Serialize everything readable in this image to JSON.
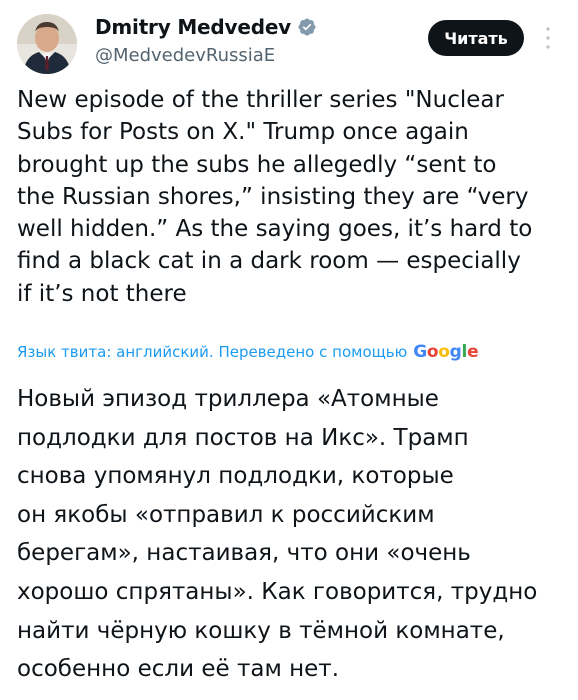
{
  "author": {
    "name": "Dmitry Medvedev",
    "handle": "@MedvedevRussiaE",
    "verified": true
  },
  "actions": {
    "read_label": "Читать",
    "more_icon": "more-vertical-icon"
  },
  "tweet": {
    "lines": [
      "New episode of the thriller series \"Nuclear",
      "Subs for Posts on X.\" Trump once again",
      "brought up the subs he allegedly “sent to",
      "the Russian shores,” insisting they are “very",
      "well hidden.” As the saying goes, it’s hard to",
      "find a black cat in a dark room — especially",
      "if it’s not there"
    ]
  },
  "translation": {
    "note": "Язык твита: английский. Переведено с помощью",
    "provider": "Google",
    "lines": [
      "Новый эпизод триллера «Атомные",
      "подлодки для постов на Икс». Трамп",
      "снова упомянул подлодки, которые",
      "он якобы «отправил к российским",
      "берегам», настаивая, что они «очень",
      "хорошо спрятаны». Как говорится, трудно",
      "найти чёрную кошку в тёмной комнате,",
      "особенно если её там нет."
    ]
  },
  "colors": {
    "text": "#0f1419",
    "secondary": "#536471",
    "link": "#1d9bf0",
    "verified": "#829aab",
    "button_bg": "#0f1419"
  }
}
